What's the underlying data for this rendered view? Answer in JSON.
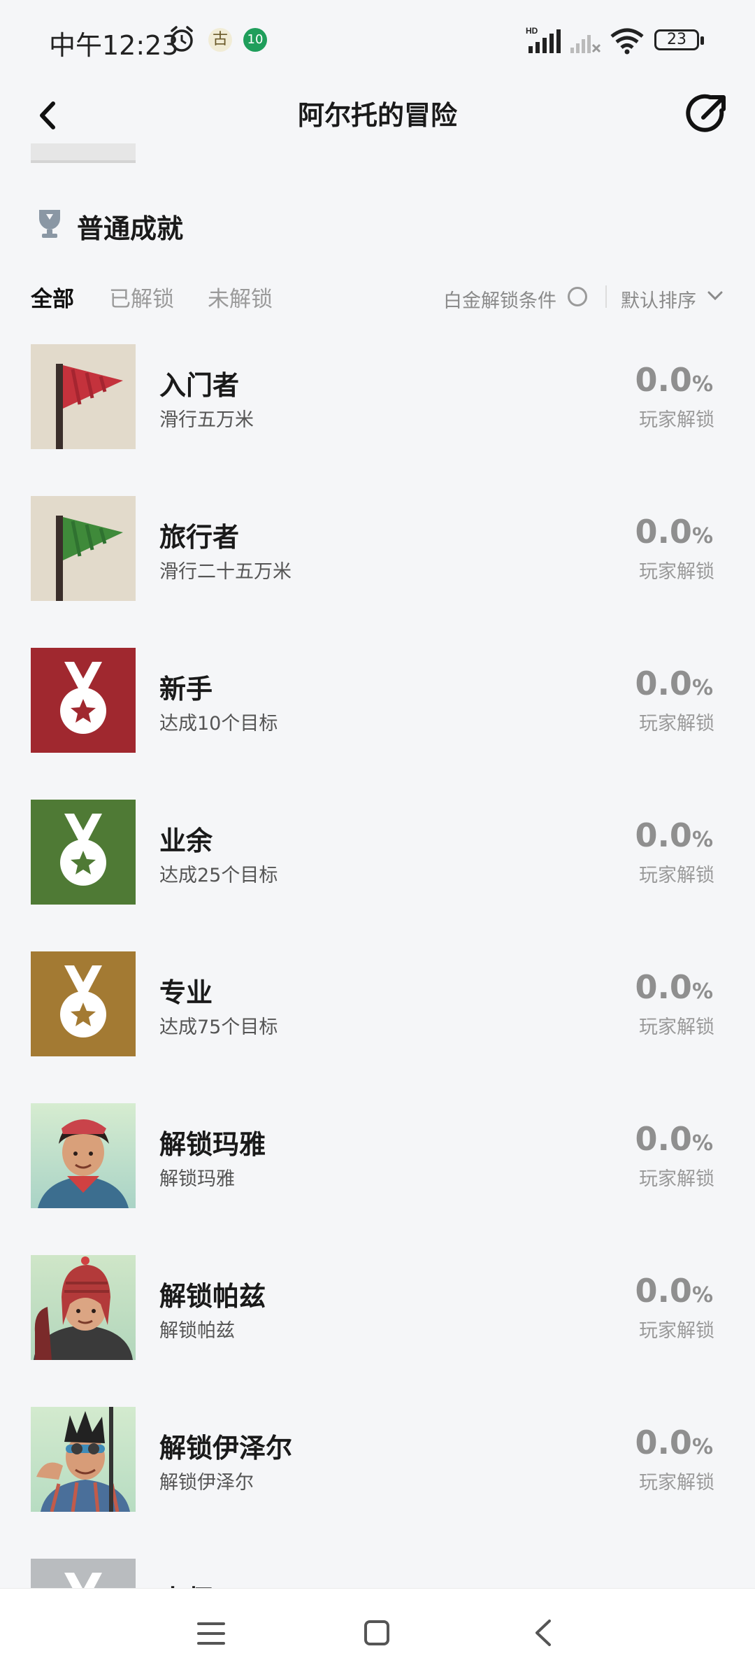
{
  "status_bar": {
    "time": "中午12:23",
    "notif_1": "古",
    "notif_2": "10",
    "battery": "23",
    "icons": [
      "alarm-icon",
      "hd-signal-icon",
      "signal-no-service-icon",
      "wifi-icon",
      "battery-icon"
    ]
  },
  "header": {
    "title": "阿尔托的冒险",
    "back_icon": "chevron-left-icon",
    "share_icon": "share-icon"
  },
  "section": {
    "title": "普通成就",
    "icon": "trophy-icon"
  },
  "filters": {
    "tabs": [
      {
        "label": "全部",
        "active": true
      },
      {
        "label": "已解锁",
        "active": false
      },
      {
        "label": "未解锁",
        "active": false
      }
    ],
    "condition_label": "白金解锁条件",
    "sort_label": "默认排序"
  },
  "achievements": [
    {
      "title": "入门者",
      "desc": "滑行五万米",
      "pct": "0.0",
      "unit": "%",
      "pct_label": "玩家解锁",
      "icon": "red-flag"
    },
    {
      "title": "旅行者",
      "desc": "滑行二十五万米",
      "pct": "0.0",
      "unit": "%",
      "pct_label": "玩家解锁",
      "icon": "green-flag"
    },
    {
      "title": "新手",
      "desc": "达成10个目标",
      "pct": "0.0",
      "unit": "%",
      "pct_label": "玩家解锁",
      "icon": "red-medal",
      "color": "#a0282f"
    },
    {
      "title": "业余",
      "desc": "达成25个目标",
      "pct": "0.0",
      "unit": "%",
      "pct_label": "玩家解锁",
      "icon": "green-medal",
      "color": "#4f7a35"
    },
    {
      "title": "专业",
      "desc": "达成75个目标",
      "pct": "0.0",
      "unit": "%",
      "pct_label": "玩家解锁",
      "icon": "gold-medal",
      "color": "#a37a33"
    },
    {
      "title": "解锁玛雅",
      "desc": "解锁玛雅",
      "pct": "0.0",
      "unit": "%",
      "pct_label": "玩家解锁",
      "icon": "character-maya"
    },
    {
      "title": "解锁帕兹",
      "desc": "解锁帕兹",
      "pct": "0.0",
      "unit": "%",
      "pct_label": "玩家解锁",
      "icon": "character-paz"
    },
    {
      "title": "解锁伊泽尔",
      "desc": "解锁伊泽尔",
      "pct": "0.0",
      "unit": "%",
      "pct_label": "玩家解锁",
      "icon": "character-izel"
    },
    {
      "title": "大师",
      "desc": "",
      "pct": "",
      "unit": "",
      "pct_label": "",
      "icon": "grey-medal"
    }
  ],
  "navbar": {
    "icons": [
      "menu-icon",
      "home-icon",
      "back-icon"
    ]
  }
}
